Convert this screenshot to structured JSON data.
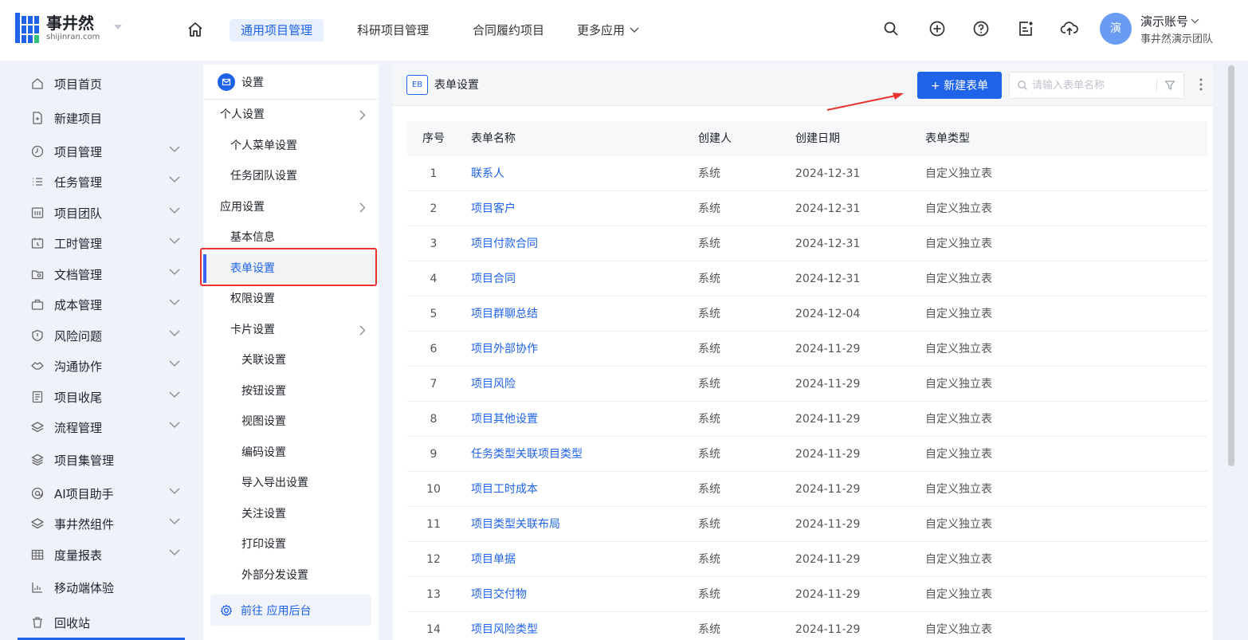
{
  "header": {
    "logo_name": "事井然",
    "logo_sub": "shijinran.com",
    "tabs": [
      {
        "label": "通用项目管理",
        "active": true
      },
      {
        "label": "科研项目管理",
        "active": false
      },
      {
        "label": "合同履约项目",
        "active": false
      }
    ],
    "more_label": "更多应用",
    "user_name": "演示账号",
    "user_team": "事井然演示团队",
    "avatar_text": "演"
  },
  "sidebar": {
    "items": [
      {
        "label": "项目首页",
        "icon": "home-outline-icon",
        "expandable": false
      },
      {
        "label": "新建项目",
        "icon": "new-doc-icon",
        "expandable": false
      },
      {
        "label": "项目管理",
        "icon": "clock-icon",
        "expandable": true
      },
      {
        "label": "任务管理",
        "icon": "list-icon",
        "expandable": true
      },
      {
        "label": "项目团队",
        "icon": "team-icon",
        "expandable": true
      },
      {
        "label": "工时管理",
        "icon": "calendar-icon",
        "expandable": true
      },
      {
        "label": "文档管理",
        "icon": "folder-icon",
        "expandable": true
      },
      {
        "label": "成本管理",
        "icon": "briefcase-icon",
        "expandable": true
      },
      {
        "label": "风险问题",
        "icon": "shield-icon",
        "expandable": true
      },
      {
        "label": "沟通协作",
        "icon": "handshake-icon",
        "expandable": true
      },
      {
        "label": "项目收尾",
        "icon": "checklist-icon",
        "expandable": true
      },
      {
        "label": "流程管理",
        "icon": "layers-icon",
        "expandable": true
      },
      {
        "label": "项目集管理",
        "icon": "stack-icon",
        "expandable": false
      },
      {
        "label": "AI项目助手",
        "icon": "at-icon",
        "expandable": true
      },
      {
        "label": "事井然组件",
        "icon": "layers-icon",
        "expandable": true
      },
      {
        "label": "度量报表",
        "icon": "table-icon",
        "expandable": true
      },
      {
        "label": "移动端体验",
        "icon": "bar-chart-icon",
        "expandable": false
      },
      {
        "label": "回收站",
        "icon": "trash-icon",
        "expandable": false
      }
    ]
  },
  "settings_panel": {
    "title": "设置",
    "items": [
      {
        "label": "个人设置",
        "level": 0,
        "arrow": true
      },
      {
        "label": "个人菜单设置",
        "level": 1,
        "arrow": false
      },
      {
        "label": "任务团队设置",
        "level": 1,
        "arrow": false
      },
      {
        "label": "应用设置",
        "level": 0,
        "arrow": true
      },
      {
        "label": "基本信息",
        "level": 1,
        "arrow": false
      },
      {
        "label": "表单设置",
        "level": 1,
        "arrow": false,
        "active": true
      },
      {
        "label": "权限设置",
        "level": 1,
        "arrow": false
      },
      {
        "label": "卡片设置",
        "level": 1,
        "arrow": true
      },
      {
        "label": "关联设置",
        "level": 2,
        "arrow": false
      },
      {
        "label": "按钮设置",
        "level": 2,
        "arrow": false
      },
      {
        "label": "视图设置",
        "level": 2,
        "arrow": false
      },
      {
        "label": "编码设置",
        "level": 2,
        "arrow": false
      },
      {
        "label": "导入导出设置",
        "level": 2,
        "arrow": false
      },
      {
        "label": "关注设置",
        "level": 2,
        "arrow": false
      },
      {
        "label": "打印设置",
        "level": 2,
        "arrow": false
      },
      {
        "label": "外部分发设置",
        "level": 2,
        "arrow": false
      }
    ],
    "goto_label": "前往 应用后台"
  },
  "main": {
    "badge": "EB",
    "title": "表单设置",
    "new_button": "+ 新建表单",
    "search_placeholder": "请输入表单名称",
    "columns": [
      "序号",
      "表单名称",
      "创建人",
      "创建日期",
      "表单类型"
    ],
    "rows": [
      {
        "no": "1",
        "name": "联系人",
        "creator": "系统",
        "date": "2024-12-31",
        "type": "自定义独立表"
      },
      {
        "no": "2",
        "name": "项目客户",
        "creator": "系统",
        "date": "2024-12-31",
        "type": "自定义独立表"
      },
      {
        "no": "3",
        "name": "项目付款合同",
        "creator": "系统",
        "date": "2024-12-31",
        "type": "自定义独立表"
      },
      {
        "no": "4",
        "name": "项目合同",
        "creator": "系统",
        "date": "2024-12-31",
        "type": "自定义独立表"
      },
      {
        "no": "5",
        "name": "项目群聊总结",
        "creator": "系统",
        "date": "2024-12-04",
        "type": "自定义独立表"
      },
      {
        "no": "6",
        "name": "项目外部协作",
        "creator": "系统",
        "date": "2024-11-29",
        "type": "自定义独立表"
      },
      {
        "no": "7",
        "name": "项目风险",
        "creator": "系统",
        "date": "2024-11-29",
        "type": "自定义独立表"
      },
      {
        "no": "8",
        "name": "项目其他设置",
        "creator": "系统",
        "date": "2024-11-29",
        "type": "自定义独立表"
      },
      {
        "no": "9",
        "name": "任务类型关联项目类型",
        "creator": "系统",
        "date": "2024-11-29",
        "type": "自定义独立表"
      },
      {
        "no": "10",
        "name": "项目工时成本",
        "creator": "系统",
        "date": "2024-11-29",
        "type": "自定义独立表"
      },
      {
        "no": "11",
        "name": "项目类型关联布局",
        "creator": "系统",
        "date": "2024-11-29",
        "type": "自定义独立表"
      },
      {
        "no": "12",
        "name": "项目单据",
        "creator": "系统",
        "date": "2024-11-29",
        "type": "自定义独立表"
      },
      {
        "no": "13",
        "name": "项目交付物",
        "creator": "系统",
        "date": "2024-11-29",
        "type": "自定义独立表"
      },
      {
        "no": "14",
        "name": "项目风险类型",
        "creator": "系统",
        "date": "2024-11-29",
        "type": "自定义独立表"
      }
    ]
  },
  "colors": {
    "accent": "#1e63e8",
    "highlight": "#e8342f",
    "page_bg": "#eff2f8"
  }
}
